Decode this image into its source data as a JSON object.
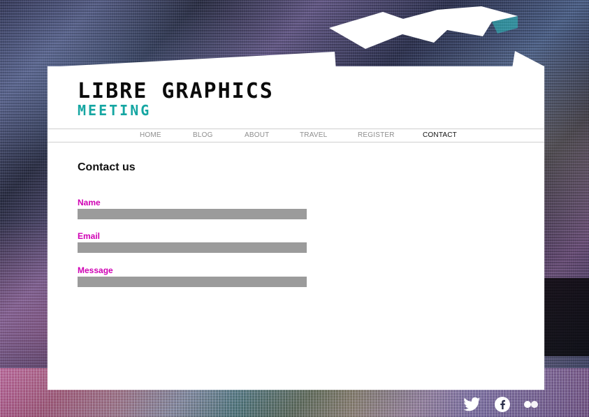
{
  "site": {
    "logo": {
      "title": "LIBRE GRAPHICS",
      "subtitle": "MEETING",
      "subtitle_color": "#15A6A2"
    }
  },
  "nav": {
    "items": [
      {
        "label": "HOME",
        "active": false
      },
      {
        "label": "BLOG",
        "active": false
      },
      {
        "label": "ABOUT",
        "active": false
      },
      {
        "label": "TRAVEL",
        "active": false
      },
      {
        "label": "REGISTER",
        "active": false
      },
      {
        "label": "CONTACT",
        "active": true
      }
    ]
  },
  "page": {
    "title": "Contact us"
  },
  "contact_form": {
    "fields": [
      {
        "label": "Name",
        "value": "",
        "placeholder": ""
      },
      {
        "label": "Email",
        "value": "",
        "placeholder": ""
      },
      {
        "label": "Message",
        "value": "",
        "placeholder": ""
      }
    ],
    "label_color": "#D000B4",
    "input_bg": "#9B9B9B"
  },
  "social": {
    "items": [
      {
        "name": "twitter-icon"
      },
      {
        "name": "facebook-icon"
      },
      {
        "name": "flickr-icon"
      }
    ]
  }
}
